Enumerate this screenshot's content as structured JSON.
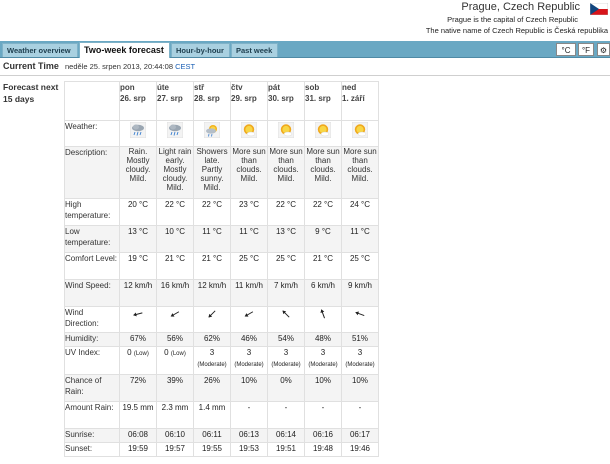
{
  "location": {
    "title": "Prague, Czech Republic",
    "subtitle1": "Prague is the capital of Czech Republic",
    "subtitle2": "The native name of Czech Republic is Česká republika"
  },
  "tabs": [
    {
      "label": "Weather overview",
      "active": false
    },
    {
      "label": "Two-week forecast",
      "active": true
    },
    {
      "label": "Hour-by-hour",
      "active": false
    },
    {
      "label": "Past week",
      "active": false
    }
  ],
  "units": {
    "celsius": "°C",
    "fahrenheit": "°F",
    "settings": "⚙"
  },
  "current_time": {
    "label": "Current Time",
    "value": "neděle 25. srpen 2013, 20:44:08",
    "tz": "CEST"
  },
  "forecast": {
    "title": "Forecast next 15 days",
    "row_labels": {
      "weather": "Weather:",
      "description": "Description:",
      "high": "High temperature:",
      "low": "Low temperature:",
      "comfort": "Comfort Level:",
      "wind_speed": "Wind Speed:",
      "wind_dir": "Wind Direction:",
      "humidity": "Humidity:",
      "uv": "UV Index:",
      "chance_rain": "Chance of Rain:",
      "amount_rain": "Amount Rain:",
      "sunrise": "Sunrise:",
      "sunset": "Sunset:"
    },
    "days": [
      {
        "dow": "pon",
        "date": "26. srp",
        "icon": "rain-cloud-icon",
        "desc": "Rain. Mostly cloudy. Mild.",
        "high": "20 °C",
        "low": "13 °C",
        "comfort": "19 °C",
        "wind": "12 km/h",
        "dir_deg": 75,
        "humidity": "67%",
        "uv": "0",
        "uv_label": "(Low)",
        "rain_chance": "72%",
        "rain_amount": "19.5 mm",
        "sunrise": "06:08",
        "sunset": "19:59"
      },
      {
        "dow": "úte",
        "date": "27. srp",
        "icon": "rain-cloud-icon",
        "desc": "Light rain early. Mostly cloudy. Mild.",
        "high": "22 °C",
        "low": "10 °C",
        "comfort": "21 °C",
        "wind": "16 km/h",
        "dir_deg": 60,
        "humidity": "56%",
        "uv": "0",
        "uv_label": "(Low)",
        "rain_chance": "39%",
        "rain_amount": "2.3 mm",
        "sunrise": "06:10",
        "sunset": "19:57"
      },
      {
        "dow": "stř",
        "date": "28. srp",
        "icon": "sun-shower-icon",
        "desc": "Showers late. Partly sunny. Mild.",
        "high": "22 °C",
        "low": "11 °C",
        "comfort": "21 °C",
        "wind": "12 km/h",
        "dir_deg": 45,
        "humidity": "62%",
        "uv": "3",
        "uv_label": "(Moderate)",
        "rain_chance": "26%",
        "rain_amount": "1.4 mm",
        "sunrise": "06:11",
        "sunset": "19:55"
      },
      {
        "dow": "čtv",
        "date": "29. srp",
        "icon": "sun-cloud-icon",
        "desc": "More sun than clouds. Mild.",
        "high": "23 °C",
        "low": "11 °C",
        "comfort": "25 °C",
        "wind": "11 km/h",
        "dir_deg": 60,
        "humidity": "46%",
        "uv": "3",
        "uv_label": "(Moderate)",
        "rain_chance": "10%",
        "rain_amount": "-",
        "sunrise": "06:13",
        "sunset": "19:53"
      },
      {
        "dow": "pát",
        "date": "30. srp",
        "icon": "sun-cloud-icon",
        "desc": "More sun than clouds. Mild.",
        "high": "22 °C",
        "low": "13 °C",
        "comfort": "25 °C",
        "wind": "7 km/h",
        "dir_deg": 135,
        "humidity": "54%",
        "uv": "3",
        "uv_label": "(Moderate)",
        "rain_chance": "0%",
        "rain_amount": "-",
        "sunrise": "06:14",
        "sunset": "19:51"
      },
      {
        "dow": "sob",
        "date": "31. srp",
        "icon": "sun-cloud-icon",
        "desc": "More sun than clouds. Mild.",
        "high": "22 °C",
        "low": "9 °C",
        "comfort": "21 °C",
        "wind": "6 km/h",
        "dir_deg": 160,
        "humidity": "48%",
        "uv": "3",
        "uv_label": "(Moderate)",
        "rain_chance": "10%",
        "rain_amount": "-",
        "sunrise": "06:16",
        "sunset": "19:48"
      },
      {
        "dow": "ned",
        "date": "1. září",
        "icon": "sun-cloud-icon",
        "desc": "More sun than clouds. Mild.",
        "high": "24 °C",
        "low": "11 °C",
        "comfort": "25 °C",
        "wind": "9 km/h",
        "dir_deg": 110,
        "humidity": "51%",
        "uv": "3",
        "uv_label": "(Moderate)",
        "rain_chance": "10%",
        "rain_amount": "-",
        "sunrise": "06:17",
        "sunset": "19:46"
      }
    ]
  }
}
